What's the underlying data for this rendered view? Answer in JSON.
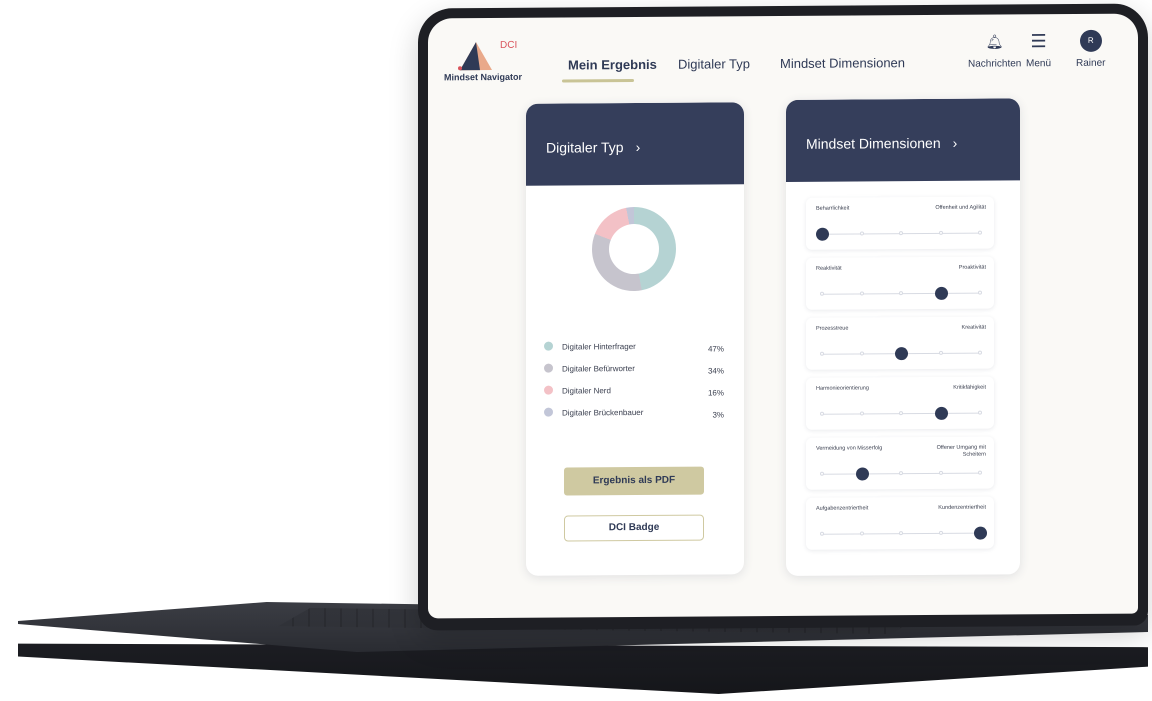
{
  "header": {
    "logo_dci": "DCI",
    "logo_name": "Mindset Navigator",
    "tabs": [
      "Mein Ergebnis",
      "Digitaler Typ",
      "Mindset Dimensionen"
    ],
    "notifications_label": "Nachrichten",
    "menu_label": "Menü",
    "user_initial": "R",
    "user_label": "Rainer"
  },
  "type_card": {
    "title": "Digitaler Typ",
    "chevron": "›",
    "legend": [
      {
        "label": "Digitaler Hinterfrager",
        "pct": "47%",
        "color": "#b5d3d3",
        "value": 47
      },
      {
        "label": "Digitaler Befürworter",
        "pct": "34%",
        "color": "#c6c4cd",
        "value": 34
      },
      {
        "label": "Digitaler Nerd",
        "pct": "16%",
        "color": "#f3c1c6",
        "value": 16
      },
      {
        "label": "Digitaler Brückenbauer",
        "pct": "3%",
        "color": "#c2c6d8",
        "value": 3
      }
    ],
    "pdf_button": "Ergebnis als PDF",
    "badge_button": "DCI Badge"
  },
  "dimensions_card": {
    "title": "Mindset Dimensionen",
    "chevron": "›",
    "items": [
      {
        "left": "Beharrlichkeit",
        "right": "Offenheit und Agilität",
        "level": 1
      },
      {
        "left": "Reaktivität",
        "right": "Proaktivität",
        "level": 4
      },
      {
        "left": "Prozesstreue",
        "right": "Kreativität",
        "level": 3
      },
      {
        "left": "Harmonieorientierung",
        "right": "Kritikfähigkeit",
        "level": 4
      },
      {
        "left": "Vermeidung von Misserfolg",
        "right": "Offener Umgang mit Scheitern",
        "level": 2
      },
      {
        "left": "Aufgabenzentriertheit",
        "right": "Kundenzentriertheit",
        "level": 5
      }
    ]
  },
  "colors": {
    "navy": "#353e5b",
    "accent": "#cfc9a1"
  }
}
